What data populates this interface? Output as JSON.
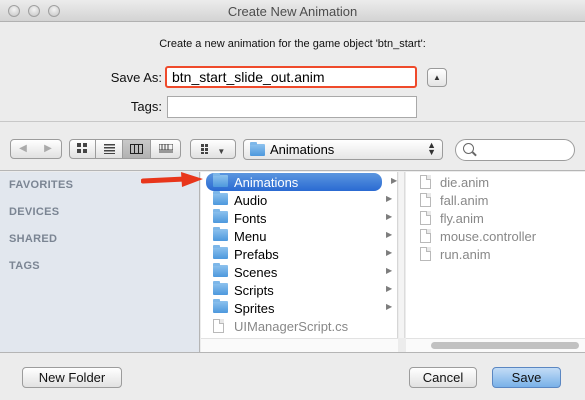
{
  "window": {
    "title": "Create New Animation"
  },
  "form": {
    "prompt": "Create a new animation for the game object 'btn_start':",
    "save_as_label": "Save As:",
    "save_as_value": "btn_start_slide_out.anim",
    "tags_label": "Tags:",
    "tags_value": ""
  },
  "toolbar": {
    "location": "Animations",
    "search_value": ""
  },
  "sidebar": {
    "sections": [
      "FAVORITES",
      "DEVICES",
      "SHARED",
      "TAGS"
    ]
  },
  "browser": {
    "column1": [
      {
        "name": "Animations",
        "kind": "folder",
        "selected": true
      },
      {
        "name": "Audio",
        "kind": "folder"
      },
      {
        "name": "Fonts",
        "kind": "folder"
      },
      {
        "name": "Menu",
        "kind": "folder"
      },
      {
        "name": "Prefabs",
        "kind": "folder"
      },
      {
        "name": "Scenes",
        "kind": "folder"
      },
      {
        "name": "Scripts",
        "kind": "folder"
      },
      {
        "name": "Sprites",
        "kind": "folder"
      },
      {
        "name": "UIManagerScript.cs",
        "kind": "file"
      }
    ],
    "column2": [
      {
        "name": "die.anim"
      },
      {
        "name": "fall.anim"
      },
      {
        "name": "fly.anim"
      },
      {
        "name": "mouse.controller"
      },
      {
        "name": "run.anim"
      }
    ]
  },
  "buttons": {
    "new_folder": "New Folder",
    "cancel": "Cancel",
    "save": "Save"
  },
  "colors": {
    "highlight": "#ef4a2b",
    "selection": "#2a6ad2"
  }
}
